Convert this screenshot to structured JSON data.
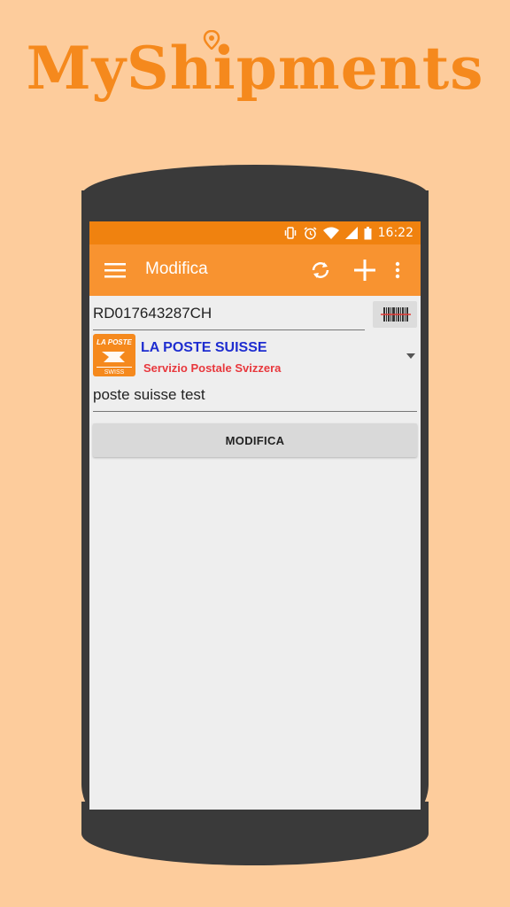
{
  "promo": {
    "title": "MyShipments"
  },
  "status_bar": {
    "time": "16:22"
  },
  "app_bar": {
    "title": "Modifica"
  },
  "form": {
    "tracking_number": "RD017643287CH",
    "carrier": {
      "name": "LA POSTE SUISSE",
      "subtitle": "Servizio Postale Svizzera",
      "logo_text_top": "LA POSTE",
      "logo_text_bottom": "SWISS"
    },
    "description": "poste suisse test",
    "submit_label": "MODIFICA"
  },
  "colors": {
    "background": "#fdcc9c",
    "brand_orange": "#f89330",
    "status_orange": "#f0820f",
    "carrier_name_blue": "#1e2dd0",
    "carrier_sub_red": "#e8383d"
  },
  "icons": [
    "map-pin-icon",
    "vibrate-icon",
    "alarm-icon",
    "wifi-icon",
    "signal-icon",
    "battery-icon",
    "menu-icon",
    "refresh-icon",
    "add-icon",
    "overflow-icon",
    "barcode-icon",
    "chevron-down-icon"
  ]
}
